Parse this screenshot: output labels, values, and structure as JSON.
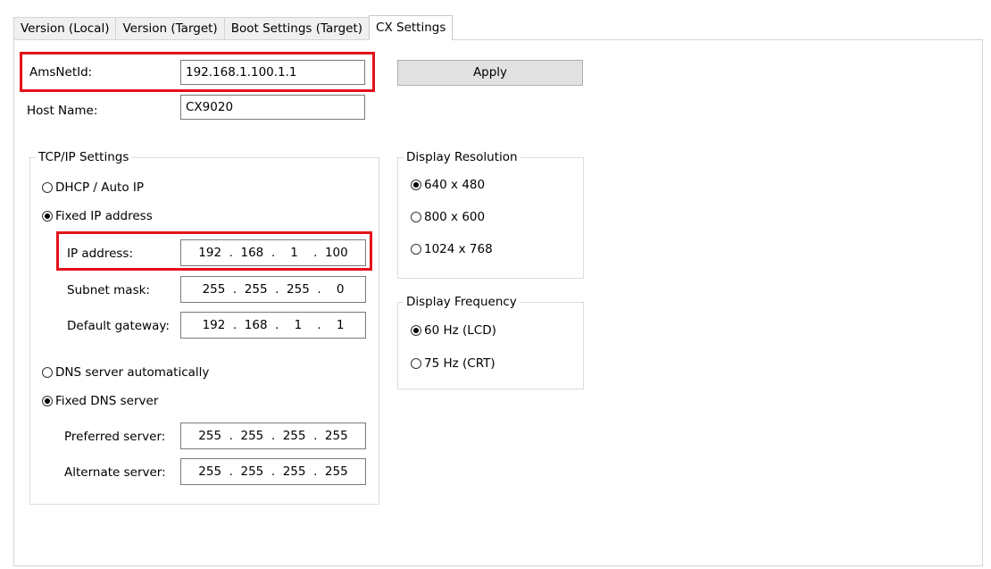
{
  "tabs": [
    {
      "label": "Version (Local)"
    },
    {
      "label": "Version (Target)"
    },
    {
      "label": "Boot Settings (Target)"
    },
    {
      "label": "CX Settings"
    }
  ],
  "amsnetid": {
    "label": "AmsNetId:",
    "value": "192.168.1.100.1.1"
  },
  "hostname": {
    "label": "Host Name:",
    "value": "CX9020"
  },
  "apply_label": "Apply",
  "tcpip": {
    "title": "TCP/IP Settings",
    "dhcp_label": "DHCP / Auto IP",
    "fixed_ip_label": "Fixed IP address",
    "ip_address": {
      "label": "IP address:",
      "value": "192  .  168  .    1    .  100"
    },
    "subnet_mask": {
      "label": "Subnet mask:",
      "value": "255  .  255  .  255  .    0"
    },
    "default_gateway": {
      "label": "Default gateway:",
      "value": "192  .  168  .    1    .    1"
    },
    "dns_auto_label": "DNS server automatically",
    "fixed_dns_label": "Fixed DNS server",
    "preferred_server": {
      "label": "Preferred server:",
      "value": "255  .  255  .  255  .  255"
    },
    "alternate_server": {
      "label": "Alternate server:",
      "value": "255  .  255  .  255  .  255"
    }
  },
  "display_resolution": {
    "title": "Display Resolution",
    "options": [
      "640 x 480",
      "800 x 600",
      "1024 x 768"
    ],
    "selected": "640 x 480"
  },
  "display_frequency": {
    "title": "Display Frequency",
    "options": [
      "60 Hz (LCD)",
      "75 Hz (CRT)"
    ],
    "selected": "60 Hz (LCD)"
  },
  "colors": {
    "highlight": "#e3121b",
    "button_face": "#e1e1e1",
    "border": "#7a7a7a"
  }
}
